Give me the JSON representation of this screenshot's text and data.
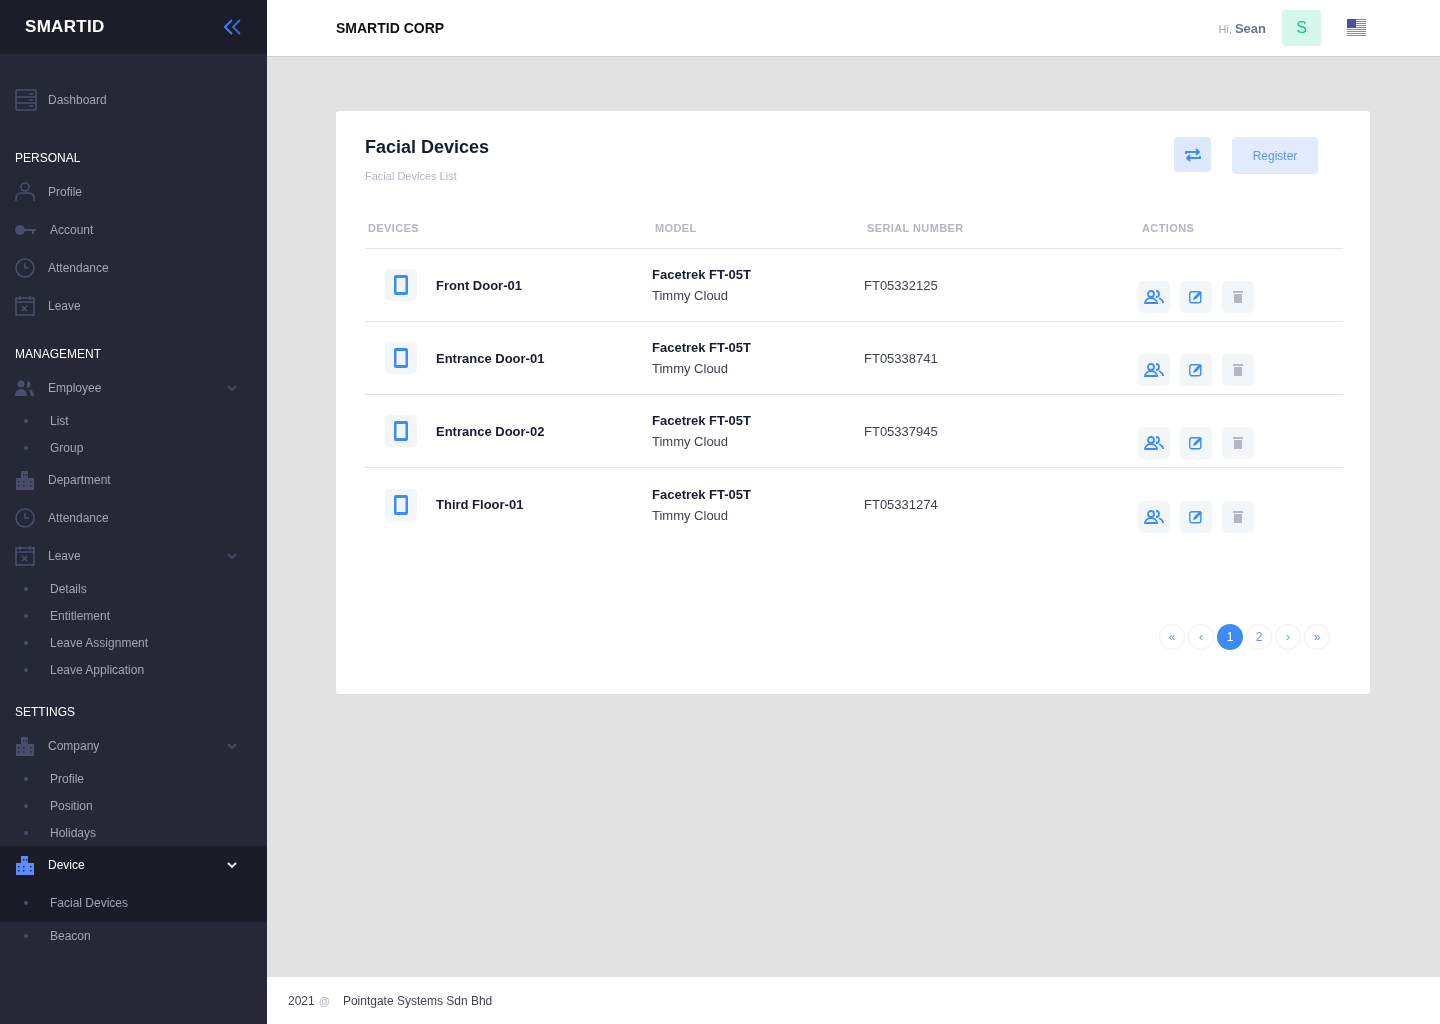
{
  "sidebar": {
    "logo": "SMARTID",
    "items": [
      {
        "kind": "link",
        "label": "Dashboard",
        "selected": false
      },
      {
        "kind": "section",
        "label": "PERSONAL"
      },
      {
        "kind": "link",
        "label": "Profile",
        "selected": false
      },
      {
        "kind": "link",
        "label": "Account",
        "selected": false
      },
      {
        "kind": "link",
        "label": "Attendance",
        "selected": false
      },
      {
        "kind": "link",
        "label": "Leave",
        "selected": false
      },
      {
        "kind": "section",
        "label": "MANAGEMENT"
      },
      {
        "kind": "group",
        "label": "Employee",
        "selected": false,
        "expanded": true,
        "children": [
          {
            "label": "List",
            "selected": false
          },
          {
            "label": "Group",
            "selected": false
          }
        ]
      },
      {
        "kind": "link",
        "label": "Department",
        "selected": false
      },
      {
        "kind": "link",
        "label": "Attendance",
        "selected": false
      },
      {
        "kind": "group",
        "label": "Leave",
        "selected": false,
        "expanded": true,
        "children": [
          {
            "label": "Details",
            "selected": false
          },
          {
            "label": "Entitlement",
            "selected": false
          },
          {
            "label": "Leave Assignment",
            "selected": false
          },
          {
            "label": "Leave Application",
            "selected": false
          }
        ]
      },
      {
        "kind": "section",
        "label": "SETTINGS"
      },
      {
        "kind": "group",
        "label": "Company",
        "selected": false,
        "expanded": true,
        "children": [
          {
            "label": "Profile",
            "selected": false
          },
          {
            "label": "Position",
            "selected": false
          },
          {
            "label": "Holidays",
            "selected": false
          }
        ]
      },
      {
        "kind": "group",
        "label": "Device",
        "selected": true,
        "expanded": true,
        "children": [
          {
            "label": "Facial Devices",
            "selected": true
          },
          {
            "label": "Beacon",
            "selected": false
          }
        ]
      }
    ]
  },
  "topbar": {
    "company": "SMARTID CORP",
    "greeting": "Hi,",
    "user": "Sean",
    "avatar": "S"
  },
  "card": {
    "title": "Facial Devices",
    "subtitle": "Facial Devices List",
    "register": "Register",
    "columns": [
      "DEVICES",
      "MODEL",
      "SERIAL NUMBER",
      "ACTIONS"
    ],
    "rows": [
      {
        "device": "Front Door-01",
        "model": "Facetrek FT-05T",
        "owner": "Timmy Cloud",
        "serial": "FT05332125"
      },
      {
        "device": "Entrance Door-01",
        "model": "Facetrek FT-05T",
        "owner": "Timmy Cloud",
        "serial": "FT05338741"
      },
      {
        "device": "Entrance Door-02",
        "model": "Facetrek FT-05T",
        "owner": "Timmy Cloud",
        "serial": "FT05337945"
      },
      {
        "device": "Third Floor-01",
        "model": "Facetrek FT-05T",
        "owner": "Timmy Cloud",
        "serial": "FT05331274"
      }
    ],
    "pagination": [
      {
        "label": "«",
        "selected": false
      },
      {
        "label": "‹",
        "selected": false
      },
      {
        "label": "1",
        "selected": true
      },
      {
        "label": "2",
        "selected": false
      },
      {
        "label": "›",
        "selected": false
      },
      {
        "label": "»",
        "selected": false
      }
    ]
  },
  "footer": {
    "year": "2021",
    "mark": "@",
    "company": "Pointgate Systems Sdn Bhd"
  }
}
